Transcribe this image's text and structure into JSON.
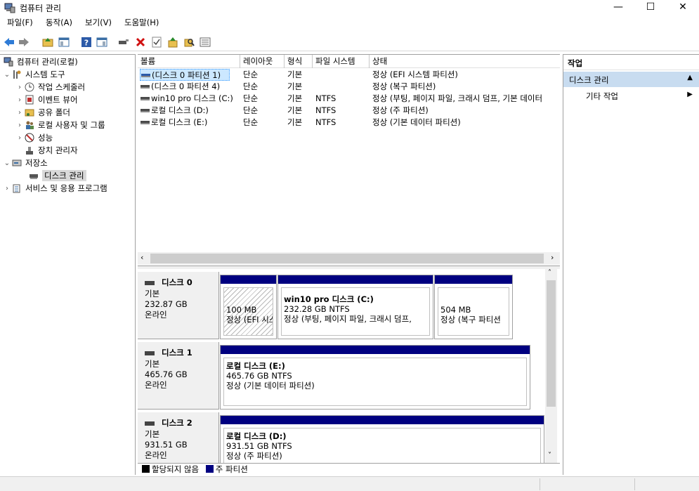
{
  "window": {
    "title": "컴퓨터 관리",
    "minimize": "—",
    "maximize": "☐",
    "close": "✕"
  },
  "menu": [
    "파일(F)",
    "동작(A)",
    "보기(V)",
    "도움말(H)"
  ],
  "toolbar": {
    "icons": [
      "back-arrow-icon",
      "forward-arrow-icon",
      "up-folder-icon",
      "show-hide-tree-icon",
      "help-icon",
      "properties-pane-icon",
      "connect-disk-icon",
      "delete-icon",
      "check-icon",
      "export-icon",
      "search-icon",
      "list-icon"
    ]
  },
  "tree": {
    "root": "컴퓨터 관리(로컬)",
    "system_tools": "시스템 도구",
    "task_scheduler": "작업 스케줄러",
    "event_viewer": "이벤트 뷰어",
    "shared_folders": "공유 폴더",
    "local_users": "로컬 사용자 및 그룹",
    "performance": "성능",
    "device_manager": "장치 관리자",
    "storage": "저장소",
    "disk_management": "디스크 관리",
    "services": "서비스 및 응용 프로그램"
  },
  "volume_table": {
    "headers": [
      "볼륨",
      "레이아웃",
      "형식",
      "파일 시스템",
      "상태"
    ],
    "rows": [
      {
        "name": "(디스크 0 파티션 1)",
        "layout": "단순",
        "type": "기본",
        "fs": "",
        "status": "정상 (EFI 시스템 파티션)"
      },
      {
        "name": "(디스크 0 파티션 4)",
        "layout": "단순",
        "type": "기본",
        "fs": "",
        "status": "정상 (복구 파티션)"
      },
      {
        "name": "win10 pro 디스크 (C:)",
        "layout": "단순",
        "type": "기본",
        "fs": "NTFS",
        "status": "정상 (부팅, 페이지 파일, 크래시 덤프, 기본 데이터"
      },
      {
        "name": "로컬 디스크 (D:)",
        "layout": "단순",
        "type": "기본",
        "fs": "NTFS",
        "status": "정상 (주 파티션)"
      },
      {
        "name": "로컬 디스크 (E:)",
        "layout": "단순",
        "type": "기본",
        "fs": "NTFS",
        "status": "정상 (기본 데이터 파티션)"
      }
    ]
  },
  "disks": [
    {
      "name": "디스크 0",
      "type": "기본",
      "size": "232.87 GB",
      "state": "온라인",
      "parts": [
        {
          "title": "",
          "size": "100 MB",
          "status": "정상 (EFI 시스"
        },
        {
          "title": "win10 pro 디스크  (C:)",
          "size": "232.28 GB NTFS",
          "status": "정상 (부팅, 페이지 파일, 크래시 덤프,"
        },
        {
          "title": "",
          "size": "504 MB",
          "status": "정상 (복구 파티션"
        }
      ]
    },
    {
      "name": "디스크 1",
      "type": "기본",
      "size": "465.76 GB",
      "state": "온라인",
      "parts": [
        {
          "title": "로컬 디스크  (E:)",
          "size": "465.76 GB NTFS",
          "status": "정상 (기본 데이터 파티션)"
        }
      ]
    },
    {
      "name": "디스크 2",
      "type": "기본",
      "size": "931.51 GB",
      "state": "온라인",
      "parts": [
        {
          "title": "로컬 디스크  (D:)",
          "size": "931.51 GB NTFS",
          "status": "정상 (주 파티션)"
        }
      ]
    }
  ],
  "legend": {
    "unallocated": "할당되지 않음",
    "primary": "주 파티션",
    "unallocated_color": "#000000",
    "primary_color": "#000080"
  },
  "actions": {
    "header": "작업",
    "section": "디스크 관리",
    "more": "기타 작업"
  },
  "colors": {
    "accent": "#000080",
    "selection": "#cce8ff",
    "action_section": "#c8dcf0"
  }
}
